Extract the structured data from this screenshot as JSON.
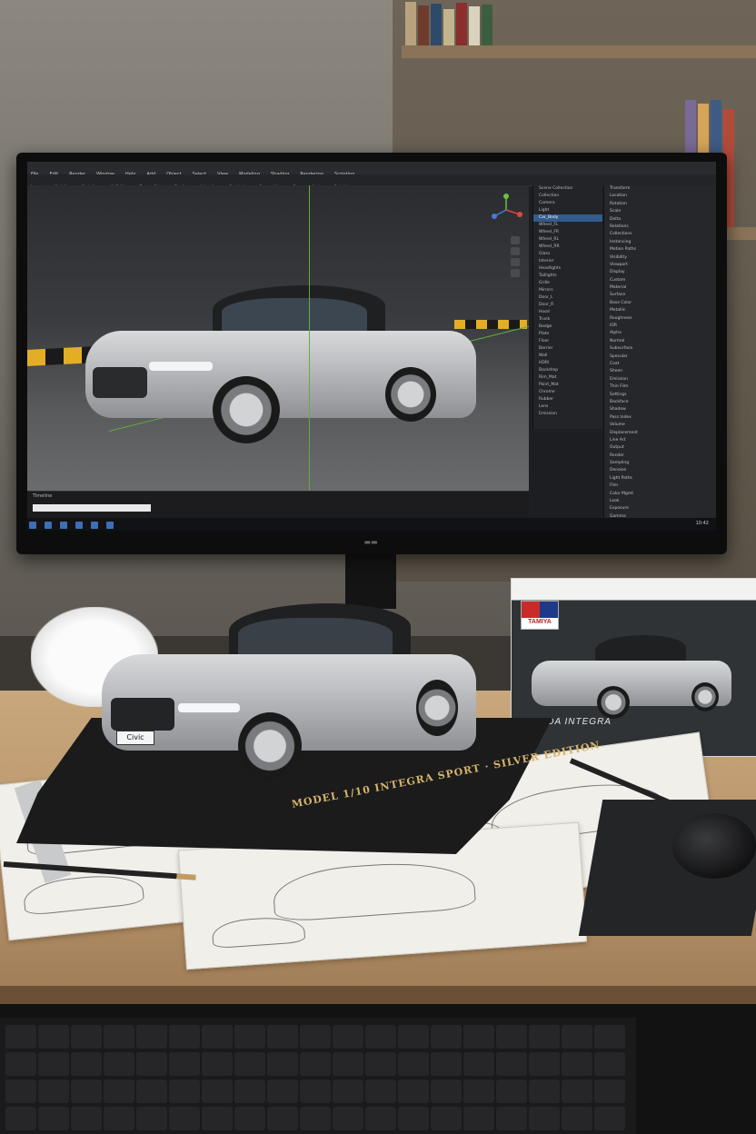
{
  "scene": {
    "description_free": true
  },
  "app": {
    "menu": [
      "File",
      "Edit",
      "Render",
      "Window",
      "Help",
      "Add",
      "Object",
      "Select",
      "View",
      "Modeling",
      "Shading",
      "Rendering",
      "Scripting"
    ],
    "toolbar": [
      "Layout",
      "Modeling",
      "Sculpting",
      "UV Editing",
      "Texture Paint",
      "Shading",
      "Animation",
      "Rendering",
      "Compositing",
      "Geometry Nodes",
      "Scripting"
    ],
    "outliner": [
      "Scene Collection",
      "Collection",
      "Camera",
      "Light",
      "Car_Body",
      "Wheel_FL",
      "Wheel_FR",
      "Wheel_RL",
      "Wheel_RR",
      "Glass",
      "Interior",
      "Headlights",
      "Taillights",
      "Grille",
      "Mirrors",
      "Door_L",
      "Door_R",
      "Hood",
      "Trunk",
      "Badge",
      "Plate",
      "Floor",
      "Barrier",
      "Wall",
      "HDRI",
      "Backdrop",
      "Rim_Mat",
      "Paint_Mat",
      "Chrome",
      "Rubber",
      "Lens",
      "Emission"
    ],
    "properties": [
      "Transform",
      "Location",
      "Rotation",
      "Scale",
      "Delta",
      "Relations",
      "Collections",
      "Instancing",
      "Motion Paths",
      "Visibility",
      "Viewport",
      "Display",
      "Custom",
      "Material",
      "Surface",
      "Base Color",
      "Metallic",
      "Roughness",
      "IOR",
      "Alpha",
      "Normal",
      "Subsurface",
      "Specular",
      "Coat",
      "Sheen",
      "Emission",
      "Thin Film",
      "Settings",
      "Backface",
      "Shadow",
      "Pass Index",
      "Volume",
      "Displacement",
      "Line Art",
      "Output",
      "Render",
      "Sampling",
      "Denoise",
      "Light Paths",
      "Film",
      "Color Mgmt",
      "Look",
      "Exposure",
      "Gamma"
    ],
    "timeline_label": "Timeline",
    "clock": "10:42"
  },
  "model": {
    "plinth_label": "MODEL 1/10 INTEGRA SPORT · SILVER EDITION",
    "plate": "Civic"
  },
  "box": {
    "brand": "TAMIYA",
    "caption": "HONDA INTEGRA"
  },
  "colors": {
    "accent_green": "#5fae3d",
    "barrier_yellow": "#e3ae25",
    "selection_blue": "#335b8c",
    "plinth_text_gold": "#d5b469",
    "car_silver": "#c3c5c8"
  }
}
